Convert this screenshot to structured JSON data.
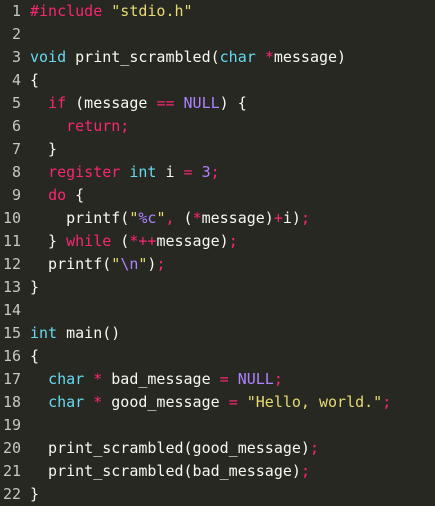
{
  "colors": {
    "background": "#272822",
    "default": "#f8f8f2",
    "line_number": "#c8c8c2",
    "keyword": "#f92672",
    "type": "#66d9ef",
    "constant": "#ae81ff",
    "string": "#e6db74",
    "preprocessor": "#f92672"
  },
  "lines": [
    {
      "n": "1",
      "tokens": [
        {
          "t": "#include ",
          "c": "preprocessor"
        },
        {
          "t": "\"stdio.h\"",
          "c": "string"
        }
      ]
    },
    {
      "n": "2",
      "tokens": []
    },
    {
      "n": "3",
      "tokens": [
        {
          "t": "void",
          "c": "type"
        },
        {
          "t": " print_scrambled(",
          "c": "default"
        },
        {
          "t": "char",
          "c": "type"
        },
        {
          "t": " ",
          "c": "default"
        },
        {
          "t": "*",
          "c": "keyword"
        },
        {
          "t": "message)",
          "c": "default"
        }
      ]
    },
    {
      "n": "4",
      "tokens": [
        {
          "t": "{",
          "c": "default"
        }
      ]
    },
    {
      "n": "5",
      "tokens": [
        {
          "t": "  ",
          "c": "default"
        },
        {
          "t": "if",
          "c": "keyword"
        },
        {
          "t": " (message ",
          "c": "default"
        },
        {
          "t": "==",
          "c": "keyword"
        },
        {
          "t": " ",
          "c": "default"
        },
        {
          "t": "NULL",
          "c": "constant"
        },
        {
          "t": ") {",
          "c": "default"
        }
      ]
    },
    {
      "n": "6",
      "tokens": [
        {
          "t": "    ",
          "c": "default"
        },
        {
          "t": "return;",
          "c": "keyword"
        }
      ]
    },
    {
      "n": "7",
      "tokens": [
        {
          "t": "  }",
          "c": "default"
        }
      ]
    },
    {
      "n": "8",
      "tokens": [
        {
          "t": "  ",
          "c": "default"
        },
        {
          "t": "register",
          "c": "keyword"
        },
        {
          "t": " ",
          "c": "default"
        },
        {
          "t": "int",
          "c": "type"
        },
        {
          "t": " i ",
          "c": "default"
        },
        {
          "t": "=",
          "c": "keyword"
        },
        {
          "t": " ",
          "c": "default"
        },
        {
          "t": "3",
          "c": "constant"
        },
        {
          "t": ";",
          "c": "keyword"
        }
      ]
    },
    {
      "n": "9",
      "tokens": [
        {
          "t": "  ",
          "c": "default"
        },
        {
          "t": "do",
          "c": "keyword"
        },
        {
          "t": " {",
          "c": "default"
        }
      ]
    },
    {
      "n": "10",
      "tokens": [
        {
          "t": "    printf(",
          "c": "default"
        },
        {
          "t": "\"",
          "c": "string"
        },
        {
          "t": "%c",
          "c": "constant"
        },
        {
          "t": "\"",
          "c": "string"
        },
        {
          "t": ", ",
          "c": "keyword"
        },
        {
          "t": "(",
          "c": "default"
        },
        {
          "t": "*",
          "c": "keyword"
        },
        {
          "t": "message)",
          "c": "default"
        },
        {
          "t": "+",
          "c": "keyword"
        },
        {
          "t": "i)",
          "c": "default"
        },
        {
          "t": ";",
          "c": "keyword"
        }
      ]
    },
    {
      "n": "11",
      "tokens": [
        {
          "t": "  } ",
          "c": "default"
        },
        {
          "t": "while",
          "c": "keyword"
        },
        {
          "t": " (",
          "c": "default"
        },
        {
          "t": "*++",
          "c": "keyword"
        },
        {
          "t": "message)",
          "c": "default"
        },
        {
          "t": ";",
          "c": "keyword"
        }
      ]
    },
    {
      "n": "12",
      "tokens": [
        {
          "t": "  printf(",
          "c": "default"
        },
        {
          "t": "\"",
          "c": "string"
        },
        {
          "t": "\\n",
          "c": "constant"
        },
        {
          "t": "\"",
          "c": "string"
        },
        {
          "t": ")",
          "c": "default"
        },
        {
          "t": ";",
          "c": "keyword"
        }
      ]
    },
    {
      "n": "13",
      "tokens": [
        {
          "t": "}",
          "c": "default"
        }
      ]
    },
    {
      "n": "14",
      "tokens": []
    },
    {
      "n": "15",
      "tokens": [
        {
          "t": "int",
          "c": "type"
        },
        {
          "t": " main()",
          "c": "default"
        }
      ]
    },
    {
      "n": "16",
      "tokens": [
        {
          "t": "{",
          "c": "default"
        }
      ]
    },
    {
      "n": "17",
      "tokens": [
        {
          "t": "  ",
          "c": "default"
        },
        {
          "t": "char",
          "c": "type"
        },
        {
          "t": " ",
          "c": "default"
        },
        {
          "t": "*",
          "c": "keyword"
        },
        {
          "t": " bad_message ",
          "c": "default"
        },
        {
          "t": "=",
          "c": "keyword"
        },
        {
          "t": " ",
          "c": "default"
        },
        {
          "t": "NULL",
          "c": "constant"
        },
        {
          "t": ";",
          "c": "keyword"
        }
      ]
    },
    {
      "n": "18",
      "tokens": [
        {
          "t": "  ",
          "c": "default"
        },
        {
          "t": "char",
          "c": "type"
        },
        {
          "t": " ",
          "c": "default"
        },
        {
          "t": "*",
          "c": "keyword"
        },
        {
          "t": " good_message ",
          "c": "default"
        },
        {
          "t": "=",
          "c": "keyword"
        },
        {
          "t": " ",
          "c": "default"
        },
        {
          "t": "\"Hello, world.\"",
          "c": "string"
        },
        {
          "t": ";",
          "c": "keyword"
        }
      ]
    },
    {
      "n": "19",
      "tokens": []
    },
    {
      "n": "20",
      "tokens": [
        {
          "t": "  print_scrambled(good_message)",
          "c": "default"
        },
        {
          "t": ";",
          "c": "keyword"
        }
      ]
    },
    {
      "n": "21",
      "tokens": [
        {
          "t": "  print_scrambled(bad_message)",
          "c": "default"
        },
        {
          "t": ";",
          "c": "keyword"
        }
      ]
    },
    {
      "n": "22",
      "tokens": [
        {
          "t": "}",
          "c": "default"
        }
      ]
    }
  ]
}
